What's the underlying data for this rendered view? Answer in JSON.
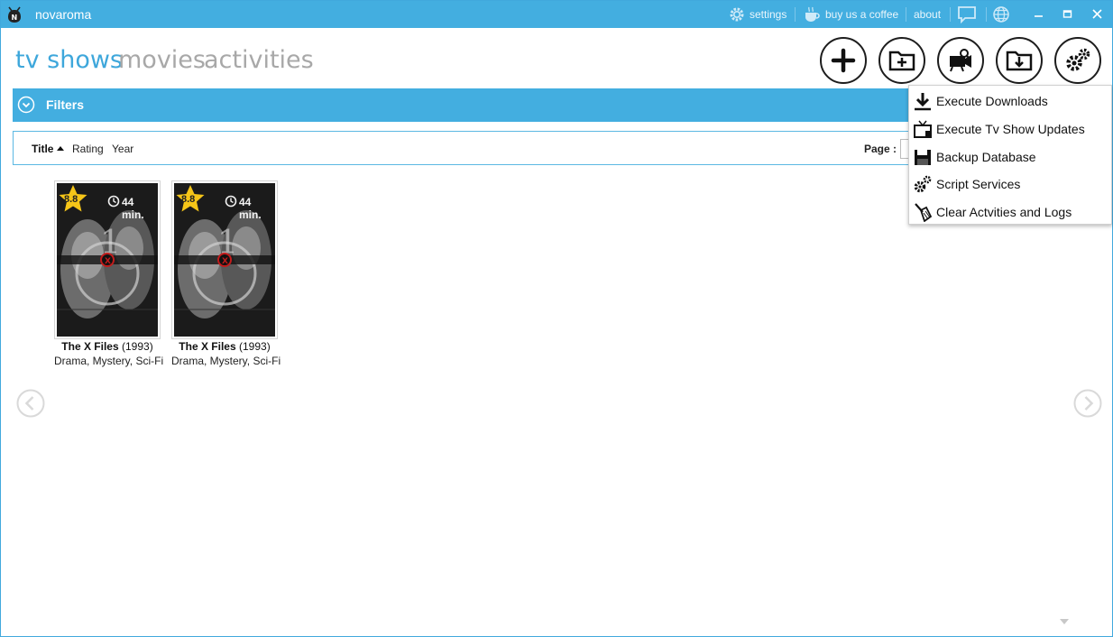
{
  "app": {
    "title": "novaroma"
  },
  "titlebar": {
    "settings_label": "settings",
    "coffee_label": "buy us a coffee",
    "about_label": "about"
  },
  "nav": {
    "tabs": [
      {
        "label": "tv shows",
        "active": true
      },
      {
        "label": "movies",
        "active": false
      },
      {
        "label": "activities",
        "active": false
      }
    ]
  },
  "toolbar": {
    "buttons": [
      {
        "icon": "plus-icon"
      },
      {
        "icon": "folder-add-icon"
      },
      {
        "icon": "movie-camera-search-icon"
      },
      {
        "icon": "folder-download-icon"
      },
      {
        "icon": "gears-icon"
      }
    ]
  },
  "filters": {
    "label": "Filters"
  },
  "sort": {
    "items": [
      "Title",
      "Rating",
      "Year"
    ],
    "active": "Title",
    "direction": "ascending",
    "page_label": "Page :"
  },
  "shows": [
    {
      "title": "The X Files",
      "year": "(1993)",
      "genres": "Drama, Mystery, Sci-Fi",
      "rating": "8.8",
      "runtime": "44 min."
    },
    {
      "title": "The X Files",
      "year": "(1993)",
      "genres": "Drama, Mystery, Sci-Fi",
      "rating": "8.8",
      "runtime": "44 min."
    }
  ],
  "menu": {
    "items": [
      {
        "label": "Execute Downloads",
        "icon": "download-icon"
      },
      {
        "label": "Execute Tv Show Updates",
        "icon": "tv-update-icon"
      },
      {
        "label": "Backup Database",
        "icon": "database-backup-icon"
      },
      {
        "label": "Script Services",
        "icon": "gears-icon"
      },
      {
        "label": "Clear Actvities and Logs",
        "icon": "broom-icon"
      }
    ]
  },
  "colors": {
    "accent": "#43aee0",
    "inactive_nav": "#a8a8a8",
    "rating_star": "#f5c518"
  }
}
